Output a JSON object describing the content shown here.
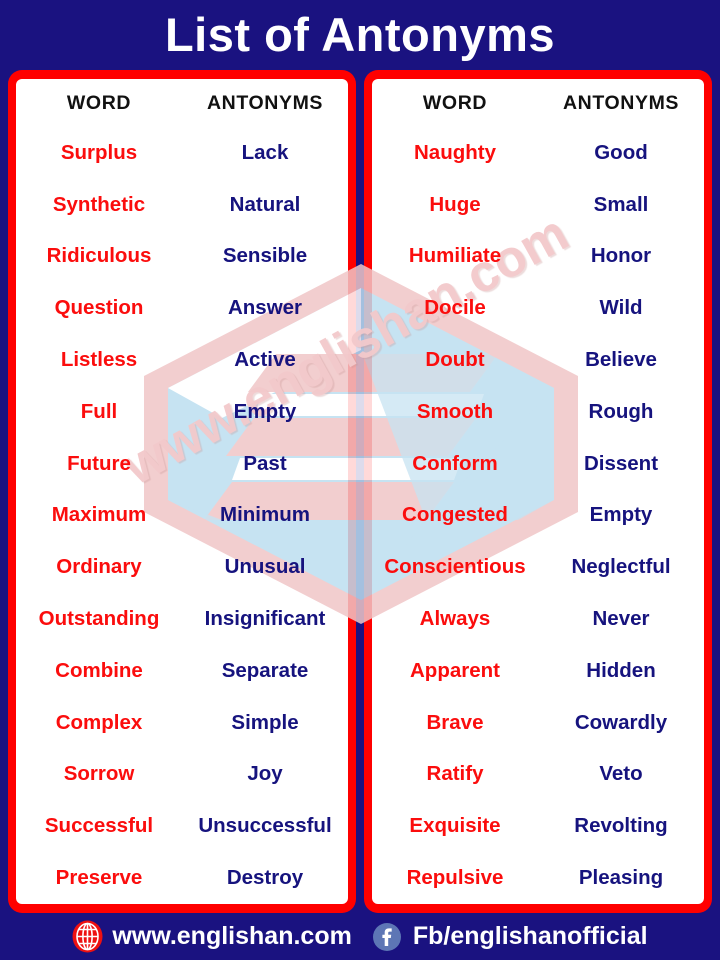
{
  "header": {
    "title": "List of Antonyms"
  },
  "colors": {
    "background": "#1a1280",
    "card_border": "#ff0000",
    "card_fill": "#ffffff",
    "word_text": "#fb0d0d",
    "antonym_text": "#16137e",
    "header_text": "#111111",
    "title_text": "#ffffff",
    "watermark_text": "#f3c9cb",
    "watermark_blue": "#b9dcef",
    "watermark_pink": "#f0c6c7"
  },
  "tables": [
    {
      "id": "left-table",
      "columns": [
        "WORD",
        "ANTONYMS"
      ],
      "rows": [
        [
          "Surplus",
          "Lack"
        ],
        [
          "Synthetic",
          "Natural"
        ],
        [
          "Ridiculous",
          "Sensible"
        ],
        [
          "Question",
          "Answer"
        ],
        [
          "Listless",
          "Active"
        ],
        [
          "Full",
          "Empty"
        ],
        [
          "Future",
          "Past"
        ],
        [
          "Maximum",
          "Minimum"
        ],
        [
          "Ordinary",
          "Unusual"
        ],
        [
          "Outstanding",
          "Insignificant"
        ],
        [
          "Combine",
          "Separate"
        ],
        [
          "Complex",
          "Simple"
        ],
        [
          "Sorrow",
          "Joy"
        ],
        [
          "Successful",
          "Unsuccessful"
        ],
        [
          "Preserve",
          "Destroy"
        ]
      ]
    },
    {
      "id": "right-table",
      "columns": [
        "WORD",
        "ANTONYMS"
      ],
      "rows": [
        [
          "Naughty",
          "Good"
        ],
        [
          "Huge",
          "Small"
        ],
        [
          "Humiliate",
          "Honor"
        ],
        [
          "Docile",
          "Wild"
        ],
        [
          "Doubt",
          "Believe"
        ],
        [
          "Smooth",
          "Rough"
        ],
        [
          "Conform",
          "Dissent"
        ],
        [
          "Congested",
          "Empty"
        ],
        [
          "Conscientious",
          "Neglectful"
        ],
        [
          "Always",
          "Never"
        ],
        [
          "Apparent",
          "Hidden"
        ],
        [
          "Brave",
          "Cowardly"
        ],
        [
          "Ratify",
          "Veto"
        ],
        [
          "Exquisite",
          "Revolting"
        ],
        [
          "Repulsive",
          "Pleasing"
        ]
      ]
    }
  ],
  "watermark": {
    "text": "www.englishan.com"
  },
  "footer": {
    "website": "www.englishan.com",
    "website_icon": "globe-icon",
    "facebook": "Fb/englishanofficial",
    "facebook_icon": "facebook-icon"
  }
}
